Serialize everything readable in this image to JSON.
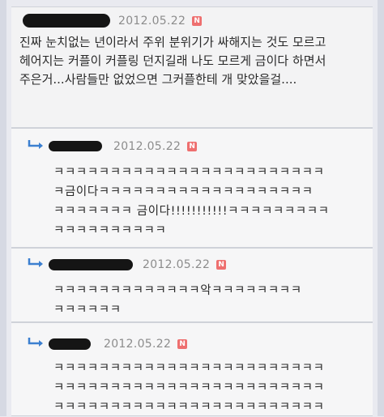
{
  "comments": [
    {
      "date": "2012.05.22",
      "badge": "N",
      "text": "진짜 눈치없는 년이라서 주위 분위기가 싸해지는 것도 모르고 헤어지는 커플이 커플링 던지길래 나도 모르게 금이다 하면서 주은거...사람들만 없었으면 그커플한테 개 맞았을걸...."
    },
    {
      "date": "2012.05.22",
      "badge": "N",
      "text": "ㅋㅋㅋㅋㅋㅋㅋㅋㅋㅋㅋㅋㅋㅋㅋㅋㅋㅋㅋㅋㅋㅋㅋㅋ\nㅋ금이다ㅋㅋㅋㅋㅋㅋㅋㅋㅋㅋㅋㅋㅋㅋㅋㅋㅋㅋㅋ\nㅋㅋㅋㅋㅋㅋㅋ 금이다!!!!!!!!!!!ㅋㅋㅋㅋㅋㅋㅋㅋㅋ\nㅋㅋㅋㅋㅋㅋㅋㅋㅋㅋ"
    },
    {
      "date": "2012.05.22",
      "badge": "N",
      "text": "ㅋㅋㅋㅋㅋㅋㅋㅋㅋㅋㅋㅋㅋ악ㅋㅋㅋㅋㅋㅋㅋㅋ\nㅋㅋㅋㅋㅋㅋ"
    },
    {
      "date": "2012.05.22",
      "badge": "N",
      "text": "ㅋㅋㅋㅋㅋㅋㅋㅋㅋㅋㅋㅋㅋㅋㅋㅋㅋㅋㅋㅋㅋㅋㅋㅋ\nㅋㅋㅋㅋㅋㅋㅋㅋㅋㅋㅋㅋㅋㅋㅋㅋㅋㅋㅋㅋㅋㅋㅋㅋ\nㅋㅋㅋㅋㅋㅋㅋㅋㅋㅋㅋㅋㅋㅋㅋㅋㅋㅋㅋㅋㅋㅋㅋㅋ"
    }
  ],
  "icons": {
    "reply": "reply-arrow-icon",
    "new_badge_color": "#ee6f6f"
  }
}
